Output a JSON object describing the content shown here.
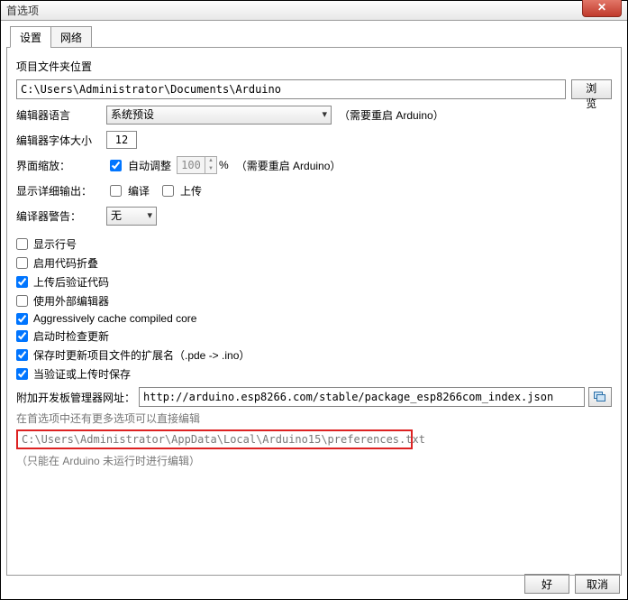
{
  "window": {
    "title": "首选项"
  },
  "tabs": {
    "settings": "设置",
    "network": "网络"
  },
  "sketchbook": {
    "section_label": "项目文件夹位置",
    "path": "C:\\Users\\Administrator\\Documents\\Arduino",
    "browse": "浏览"
  },
  "editor_language": {
    "label": "编辑器语言",
    "value": "系统预设",
    "restart_note": "（需要重启 Arduino）"
  },
  "font_size": {
    "label": "编辑器字体大小",
    "value": "12"
  },
  "scale": {
    "label": "界面缩放：",
    "auto_label": "自动调整",
    "auto_checked": true,
    "value": "100",
    "percent": "%",
    "restart_note": "（需要重启 Arduino）"
  },
  "verbose": {
    "label": "显示详细输出：",
    "compile_label": "编译",
    "compile_checked": false,
    "upload_label": "上传",
    "upload_checked": false
  },
  "warnings": {
    "label": "编译器警告：",
    "value": "无"
  },
  "checks": [
    {
      "label": "显示行号",
      "checked": false
    },
    {
      "label": "启用代码折叠",
      "checked": false
    },
    {
      "label": "上传后验证代码",
      "checked": true
    },
    {
      "label": "使用外部编辑器",
      "checked": false
    },
    {
      "label": "Aggressively cache compiled core",
      "checked": true
    },
    {
      "label": "启动时检查更新",
      "checked": true
    },
    {
      "label": "保存时更新项目文件的扩展名（.pde -> .ino）",
      "checked": true
    },
    {
      "label": "当验证或上传时保存",
      "checked": true
    }
  ],
  "boards_url": {
    "label": "附加开发板管理器网址：",
    "value": "http://arduino.esp8266.com/stable/package_esp8266com_index.json"
  },
  "more_prefs_note": "在首选项中还有更多选项可以直接编辑",
  "prefs_path": "C:\\Users\\Administrator\\AppData\\Local\\Arduino15\\preferences.txt",
  "edit_when_note": "（只能在 Arduino 未运行时进行编辑）",
  "footer": {
    "ok": "好",
    "cancel": "取消"
  }
}
